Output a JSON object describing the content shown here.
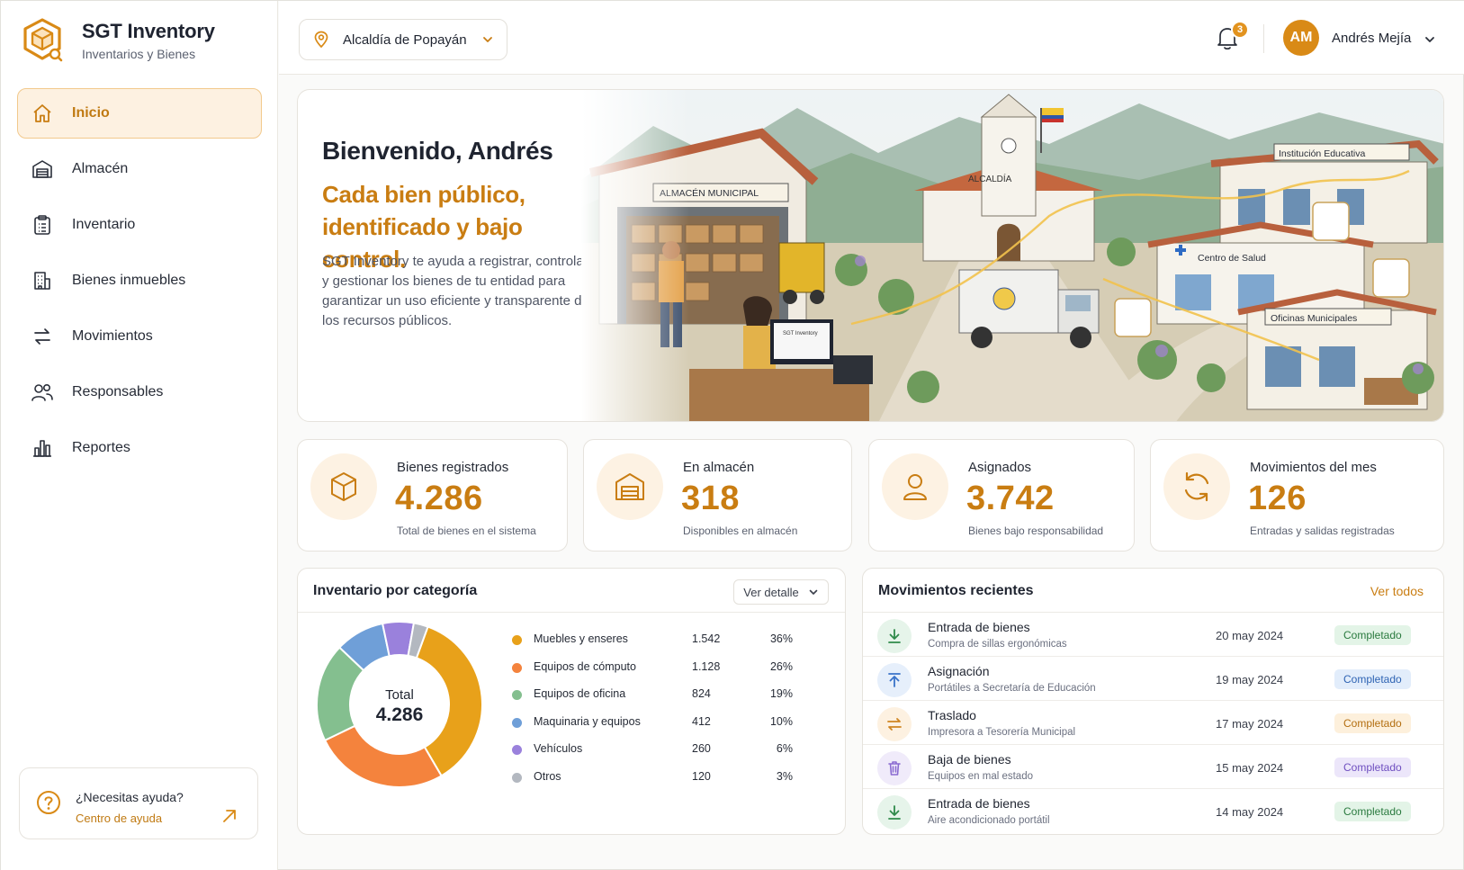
{
  "colors": {
    "accent": "#c97d12",
    "accent_light": "#fdf2e3",
    "text": "#1f2430"
  },
  "brand": {
    "title": "SGT Inventory",
    "subtitle": "Inventarios y Bienes",
    "icon": "box-logo-icon"
  },
  "sidebar": {
    "items": [
      {
        "label": "Inicio",
        "icon": "home-icon",
        "active": true
      },
      {
        "label": "Almacén",
        "icon": "warehouse-icon",
        "active": false
      },
      {
        "label": "Inventario",
        "icon": "clipboard-icon",
        "active": false
      },
      {
        "label": "Bienes inmuebles",
        "icon": "building-icon",
        "active": false
      },
      {
        "label": "Movimientos",
        "icon": "arrows-icon",
        "active": false
      },
      {
        "label": "Responsables",
        "icon": "users-icon",
        "active": false
      },
      {
        "label": "Reportes",
        "icon": "bar-chart-icon",
        "active": false
      }
    ],
    "help": {
      "title": "¿Necesitas ayuda?",
      "link": "Centro de ayuda"
    }
  },
  "topbar": {
    "entity": "Alcaldía de Popayán",
    "notifications": "3",
    "avatar_initials": "AM",
    "user_name": "Andrés Mejía"
  },
  "hero": {
    "greeting": "Bienvenido, Andrés",
    "headline": "Cada bien público, identificado y bajo control.",
    "body": "SGT Inventory te ayuda a registrar, controlar y gestionar los bienes de tu entidad para garantizar un uso eficiente y transparente de los recursos públicos.",
    "illustration_labels": {
      "warehouse": "ALMACÉN MUNICIPAL",
      "city_hall": "ALCALDÍA",
      "school": "Institución Educativa",
      "health": "Centro de Salud",
      "offices": "Oficinas Municipales",
      "screen": "SGT Inventory"
    }
  },
  "stats": [
    {
      "title": "Bienes registrados",
      "value": "4.286",
      "sub": "Total de bienes en el sistema",
      "icon": "cube-icon"
    },
    {
      "title": "En almacén",
      "value": "318",
      "sub": "Disponibles en almacén",
      "icon": "warehouse-icon"
    },
    {
      "title": "Asignados",
      "value": "3.742",
      "sub": "Bienes bajo responsabilidad",
      "icon": "user-icon"
    },
    {
      "title": "Movimientos del mes",
      "value": "126",
      "sub": "Entradas y salidas registradas",
      "icon": "refresh-icon"
    }
  ],
  "category_panel": {
    "title": "Inventario por categoría",
    "detail_button": "Ver detalle",
    "center_label": "Total",
    "center_value": "4.286"
  },
  "chart_data": {
    "type": "pie",
    "categories": [
      "Muebles y enseres",
      "Equipos de cómputo",
      "Equipos de oficina",
      "Maquinaria y equipos",
      "Vehículos",
      "Otros"
    ],
    "values": [
      1542,
      1128,
      824,
      412,
      260,
      120
    ],
    "value_labels": [
      "1.542",
      "1.128",
      "824",
      "412",
      "260",
      "120"
    ],
    "percent_labels": [
      "36%",
      "26%",
      "19%",
      "10%",
      "6%",
      "3%"
    ],
    "colors": [
      "#e8a11a",
      "#f4833d",
      "#84bf8f",
      "#6f9fd8",
      "#9a81dc",
      "#b3b8c0"
    ],
    "legend": "right"
  },
  "movements_panel": {
    "title": "Movimientos recientes",
    "see_all": "Ver todos",
    "rows": [
      {
        "title": "Entrada de bienes",
        "sub": "Compra de sillas ergonómicas",
        "date": "20 may 2024",
        "status": "Completado",
        "icon": "download-arrow-icon",
        "icon_color": "#2f8a4a",
        "icon_bg": "#e6f4ea",
        "badge_bg": "#e3f4e7",
        "badge_color": "#2a7a3f"
      },
      {
        "title": "Asignación",
        "sub": "Portátiles a Secretaría de Educación",
        "date": "19 may 2024",
        "status": "Completado",
        "icon": "upload-arrow-icon",
        "icon_color": "#3a73c9",
        "icon_bg": "#e6effb",
        "badge_bg": "#e2edfb",
        "badge_color": "#2e63b3"
      },
      {
        "title": "Traslado",
        "sub": "Impresora a Tesorería Municipal",
        "date": "17 may 2024",
        "status": "Completado",
        "icon": "swap-arrows-icon",
        "icon_color": "#cf8420",
        "icon_bg": "#fdf1e1",
        "badge_bg": "#fdf0dc",
        "badge_color": "#b36e10"
      },
      {
        "title": "Baja de bienes",
        "sub": "Equipos en mal estado",
        "date": "15 may 2024",
        "status": "Completado",
        "icon": "trash-icon",
        "icon_color": "#8a6bd1",
        "icon_bg": "#f0ebfa",
        "badge_bg": "#ece6fa",
        "badge_color": "#6f4fc0"
      },
      {
        "title": "Entrada de bienes",
        "sub": "Aire acondicionado portátil",
        "date": "14 may 2024",
        "status": "Completado",
        "icon": "download-arrow-icon",
        "icon_color": "#2f8a4a",
        "icon_bg": "#e6f4ea",
        "badge_bg": "#e3f4e7",
        "badge_color": "#2a7a3f"
      }
    ]
  }
}
